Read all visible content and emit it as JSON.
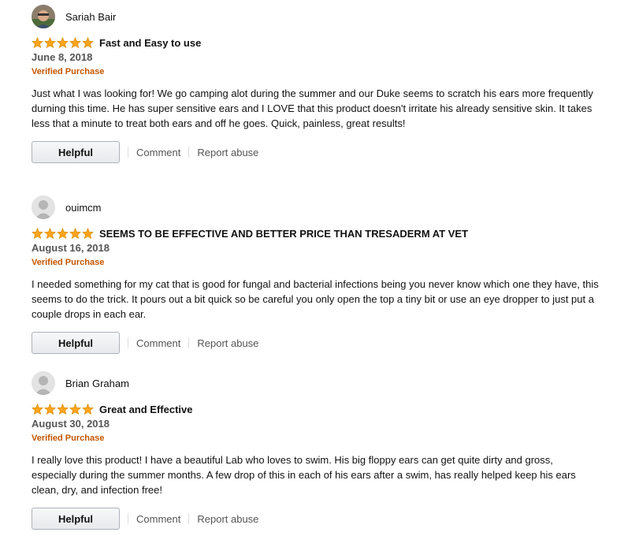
{
  "reviews": [
    {
      "author": "Sariah Bair",
      "avatar": "user-photo",
      "rating": 5,
      "title": "Fast and Easy to use",
      "date": "June 8, 2018",
      "verified": "Verified Purchase",
      "body": "Just what I was looking for! We go camping alot during the summer and our Duke seems to scratch his ears more frequently durning this time. He has super sensitive ears and I LOVE that this product doesn't irritate his already sensitive skin. It takes less that a minute to treat both ears and off he goes. Quick, painless, great results!",
      "helpful_label": "Helpful",
      "comment_label": "Comment",
      "report_label": "Report abuse"
    },
    {
      "author": "ouimcm",
      "avatar": "default-user",
      "rating": 5,
      "title": "SEEMS TO BE EFFECTIVE AND BETTER PRICE THAN TRESADERM AT VET",
      "date": "August 16, 2018",
      "verified": "Verified Purchase",
      "body": "I needed something for my cat that is good for fungal and bacterial infections being you never know which one they have, this seems to do the trick. It pours out a bit quick so be careful you only open the top a tiny bit or use an eye dropper to just put a couple drops in each ear.",
      "helpful_label": "Helpful",
      "comment_label": "Comment",
      "report_label": "Report abuse"
    },
    {
      "author": "Brian Graham",
      "avatar": "default-user",
      "rating": 5,
      "title": "Great and Effective",
      "date": "August 30, 2018",
      "verified": "Verified Purchase",
      "body": "I really love this product! I have a beautiful Lab who loves to swim. His big floppy ears can get quite dirty and gross, especially during the summer months. A few drop of this in each of his ears after a swim, has really helped keep his ears clean, dry, and infection free!",
      "helpful_label": "Helpful",
      "comment_label": "Comment",
      "report_label": "Report abuse"
    }
  ],
  "colors": {
    "star": "#ffa41c",
    "verified": "#c45500",
    "link": "#555555"
  }
}
